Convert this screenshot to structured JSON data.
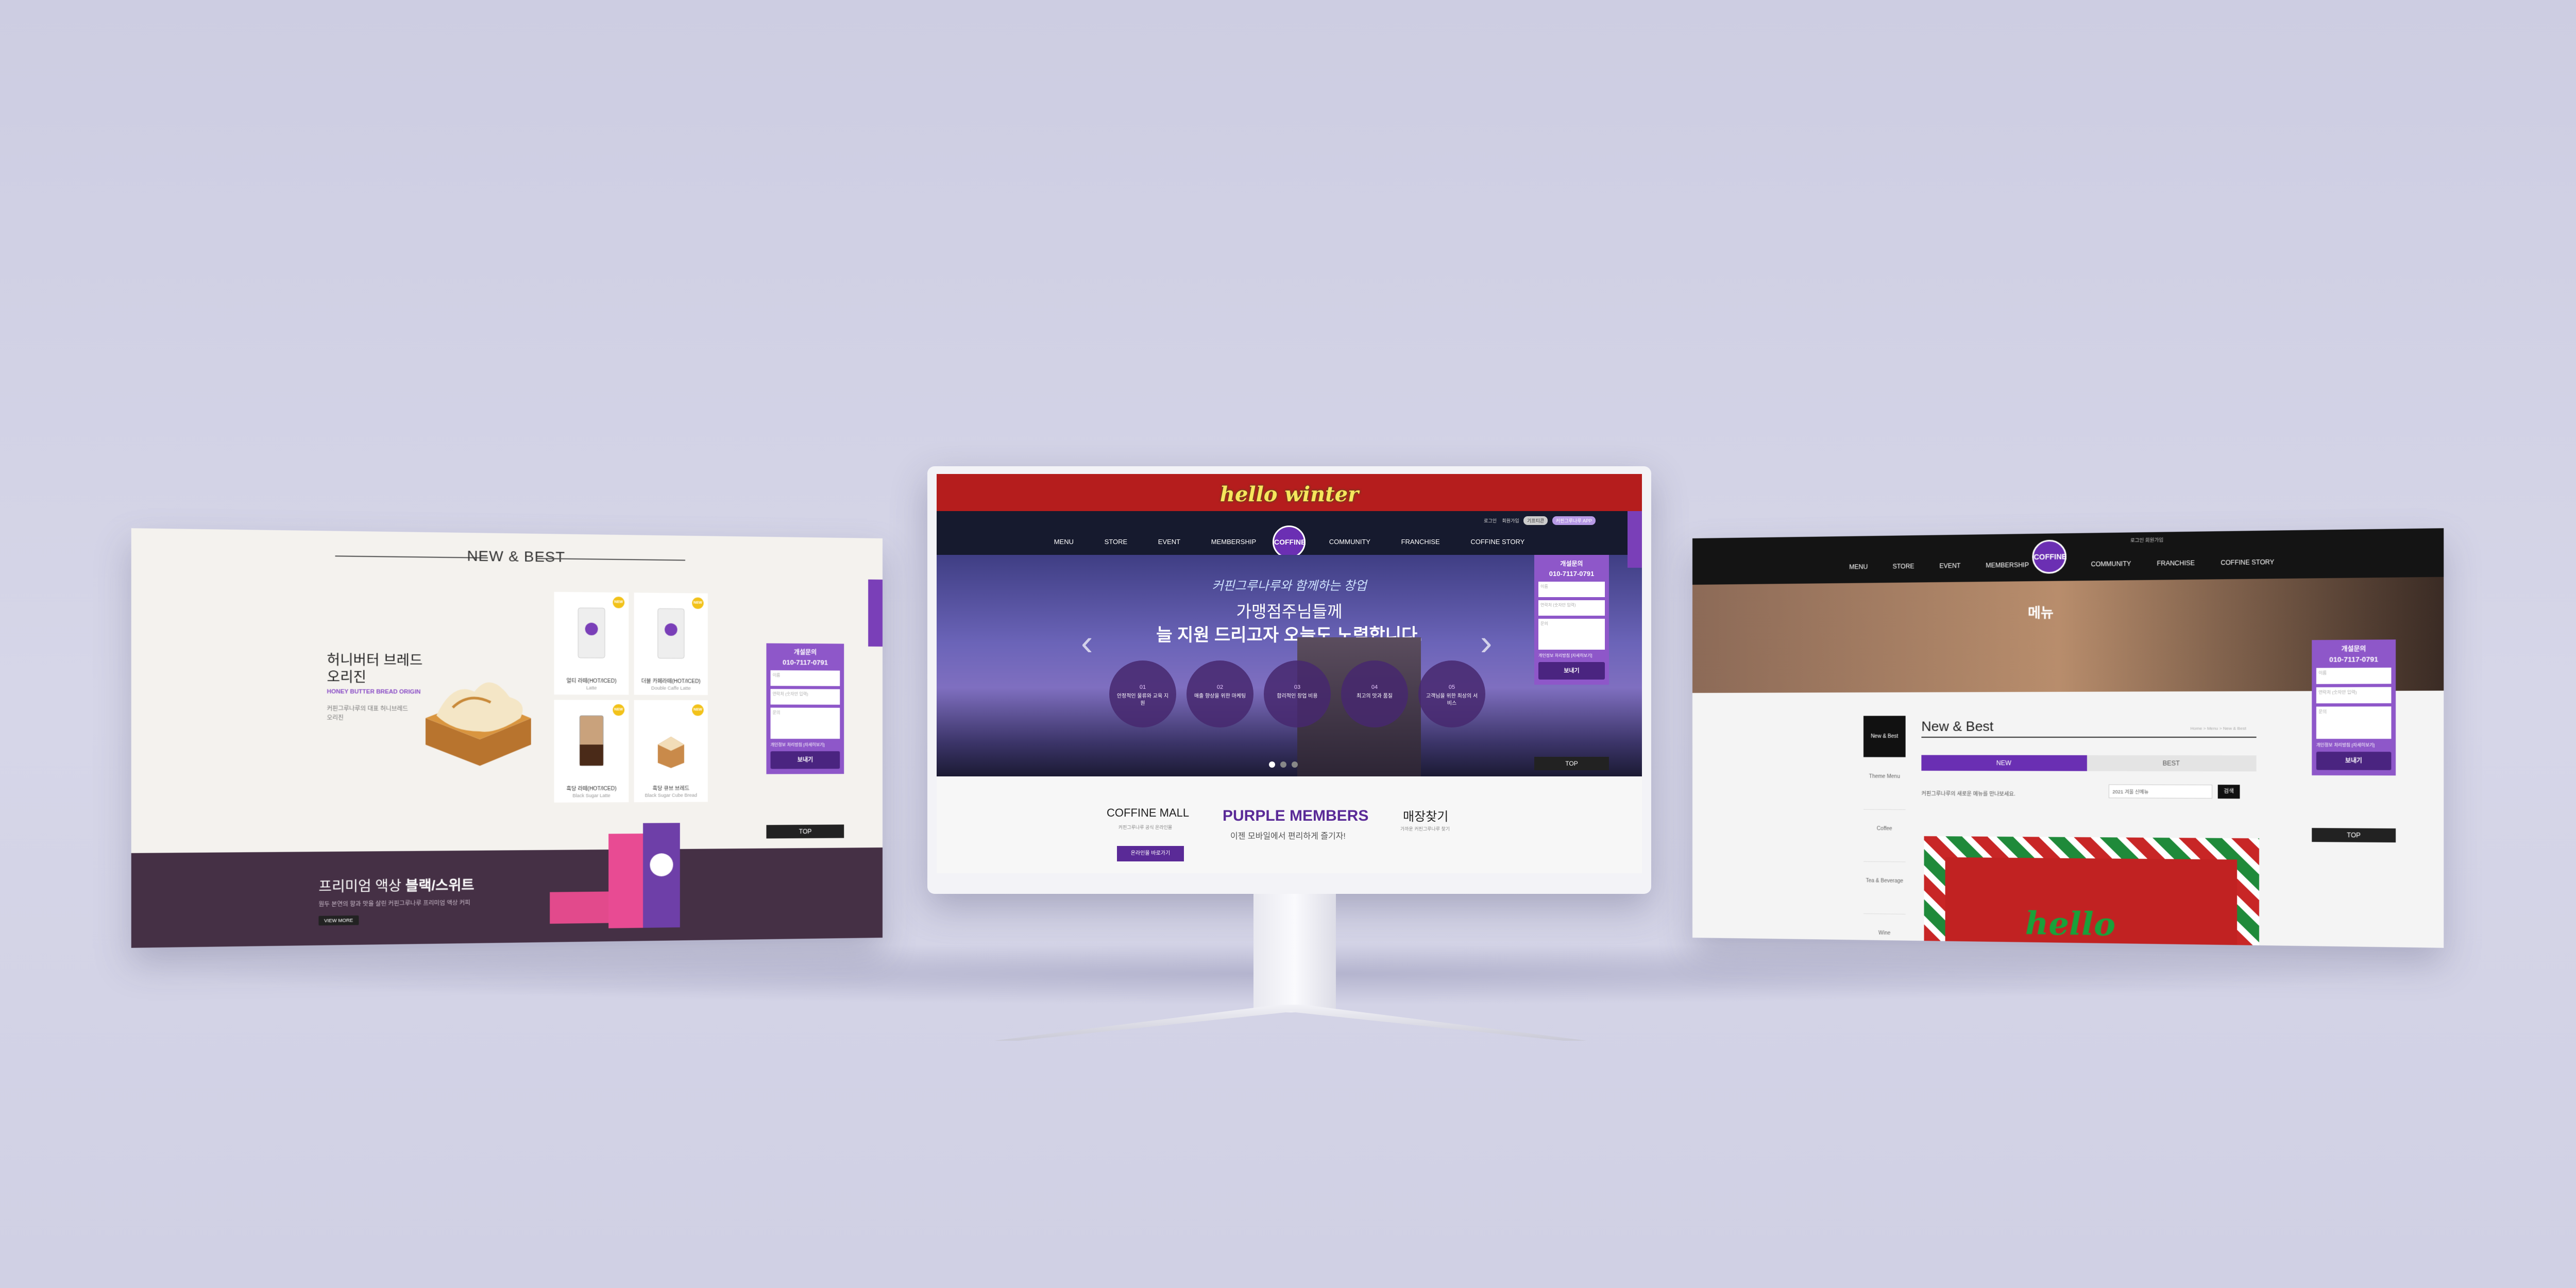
{
  "left": {
    "section_title": "NEW & BEST",
    "featured": {
      "name": "허니버터 브레드 오리진",
      "name_en": "HONEY BUTTER BREAD ORIGIN",
      "desc": "커핀그루나루의 대표 허니브레드 오리진"
    },
    "grid": [
      {
        "name": "얼티 라떼(HOT/ICED)",
        "en": "Latte",
        "badge": "NEW"
      },
      {
        "name": "더블 카페라떼(HOT/ICED)",
        "en": "Double Caffe Latte",
        "badge": "NEW"
      },
      {
        "name": "흑당 라떼(HOT/ICED)",
        "en": "Black Sugar Latte",
        "badge": "NEW"
      },
      {
        "name": "흑당 큐브 브레드",
        "en": "Black Sugar Cube Bread",
        "badge": "NEW"
      }
    ],
    "banner": {
      "title_plain": "프리미엄 액상 ",
      "title_bold": "블랙/스위트",
      "desc": "원두 본연의 향과 맛을 살린 커핀그루나루 프리미엄 액상 커피",
      "more": "VIEW MORE"
    }
  },
  "consult": {
    "title": "개설문의",
    "phone": "010-7117-0791",
    "name_ph": "이름",
    "phone_ph": "연락처 (숫자만 입력)",
    "content_ph": "문의",
    "agree": "개인정보 처리방침 [자세히보기]",
    "send": "보내기",
    "top": "TOP"
  },
  "center": {
    "promo": "hello winter",
    "util": {
      "login": "로그인",
      "join": "회원가입",
      "pill1": "기프티콘",
      "pill2": "커핀그루나루 APP"
    },
    "nav": [
      "MENU",
      "STORE",
      "EVENT",
      "MEMBERSHIP",
      "COMMUNITY",
      "FRANCHISE",
      "COFFINE STORY"
    ],
    "logo": "COFFINE",
    "hero": {
      "script": "커핀그루나루와 함께하는 창업",
      "line1": "가맹점주님들께",
      "line2": "늘 지원 드리고자 오늘도 노력합니다."
    },
    "circles": [
      {
        "n": "01",
        "t": "안정적인 물류와 교육 지원"
      },
      {
        "n": "02",
        "t": "매출 향상을 위한 마케팅"
      },
      {
        "n": "03",
        "t": "합리적인 창업 비용"
      },
      {
        "n": "04",
        "t": "최고의 맛과 품질"
      },
      {
        "n": "05",
        "t": "고객님을 위한 최상의 서비스"
      }
    ],
    "mall": {
      "title": "COFFINE MALL",
      "sub": "커핀그루나루 공식 온라인몰",
      "btn": "온라인몰 바로가기"
    },
    "members": {
      "title": "PURPLE MEMBERS",
      "sub": "이젠 모바일에서 편리하게 즐기자!"
    },
    "store": {
      "title": "매장찾기",
      "sub": "가까운 커핀그루나루 찾기"
    }
  },
  "right": {
    "util": "로그인  회원가입",
    "nav": [
      "MENU",
      "STORE",
      "EVENT",
      "MEMBERSHIP",
      "COMMUNITY",
      "FRANCHISE",
      "COFFINE STORY"
    ],
    "hero_text": "메뉴",
    "sidebar": [
      "New & Best",
      "Theme Menu",
      "Coffee",
      "Tea & Beverage",
      "Wine"
    ],
    "title": "New & Best",
    "breadcrumb": "Home > Menu > New & Best",
    "tabs": [
      "NEW",
      "BEST"
    ],
    "filter_label": "커핀그루나루의 새로운 메뉴를 만나보세요.",
    "select_value": "2021 겨울 신메뉴",
    "go": "검색",
    "card_text": "hello"
  },
  "colors": {
    "purple": "#6a2fb3",
    "dark": "#161a2e",
    "banner": "#453045",
    "xmas_red": "#b51d1d"
  }
}
